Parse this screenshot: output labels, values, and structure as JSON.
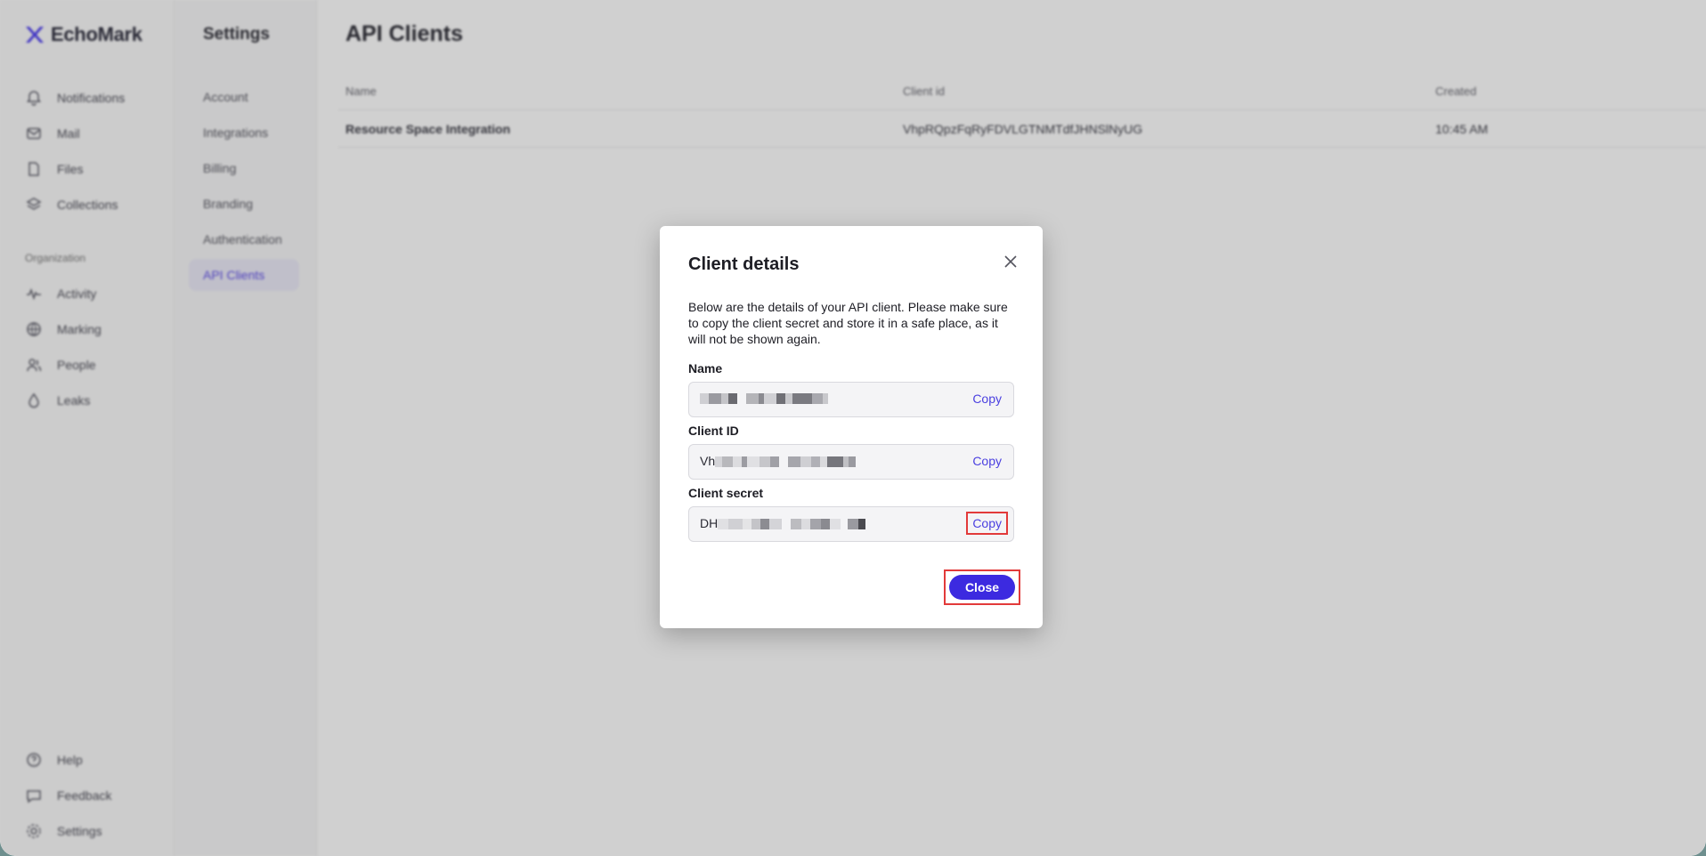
{
  "app": {
    "brand": "EchoMark",
    "accent_color": "#3c2ae0"
  },
  "nav": {
    "items": [
      {
        "label": "Notifications",
        "icon": "bell-icon"
      },
      {
        "label": "Mail",
        "icon": "mail-icon"
      },
      {
        "label": "Files",
        "icon": "file-icon"
      },
      {
        "label": "Collections",
        "icon": "stack-icon"
      }
    ],
    "section_label": "Organization",
    "org_items": [
      {
        "label": "Activity",
        "icon": "activity-icon"
      },
      {
        "label": "Marking",
        "icon": "globe-icon"
      },
      {
        "label": "People",
        "icon": "people-icon"
      },
      {
        "label": "Leaks",
        "icon": "drop-icon"
      }
    ],
    "bottom_items": [
      {
        "label": "Help",
        "icon": "help-icon"
      },
      {
        "label": "Feedback",
        "icon": "chat-icon"
      },
      {
        "label": "Settings",
        "icon": "gear-icon"
      }
    ]
  },
  "settings": {
    "title": "Settings",
    "items": [
      "Account",
      "Integrations",
      "Billing",
      "Branding",
      "Authentication",
      "API Clients"
    ],
    "active": "API Clients"
  },
  "main": {
    "title": "API Clients",
    "columns": [
      "Name",
      "Client id",
      "Created"
    ],
    "rows": [
      {
        "name": "Resource Space Integration",
        "client_id": "VhpRQpzFqRyFDVLGTNMTdfJHNSlNyUG",
        "created": "10:45 AM"
      }
    ]
  },
  "modal": {
    "title": "Client details",
    "description": "Below are the details of your API client. Please make sure to copy the client secret and store it in a safe place, as it will not be shown again.",
    "fields": [
      {
        "label": "Name",
        "value_prefix": "",
        "copy_label": "Copy"
      },
      {
        "label": "Client ID",
        "value_prefix": "Vh",
        "copy_label": "Copy"
      },
      {
        "label": "Client secret",
        "value_prefix": "DH",
        "copy_label": "Copy"
      }
    ],
    "close_label": "Close"
  }
}
